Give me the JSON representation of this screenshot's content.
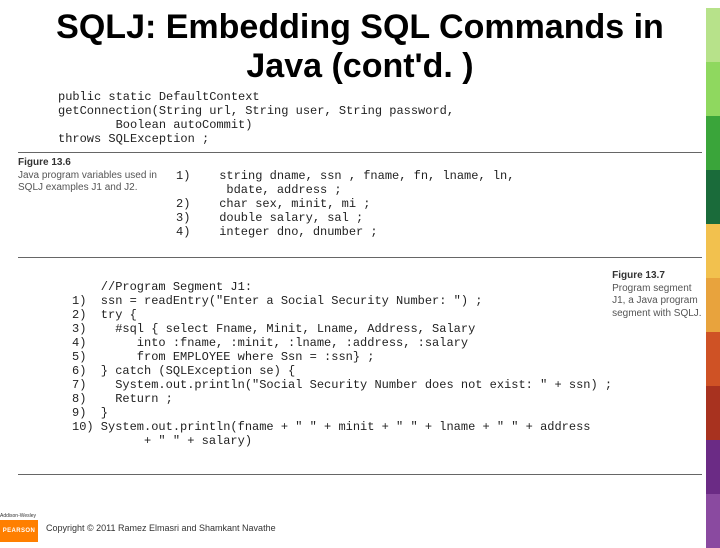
{
  "title": "SQLJ: Embedding SQL Commands in Java (cont'd. )",
  "code_block1": "public static DefaultContext\ngetConnection(String url, String user, String password,\n        Boolean autoCommit)\nthrows SQLException ;",
  "fig136": {
    "label": "Figure 13.6",
    "caption": "Java program variables used in SQLJ examples J1 and J2."
  },
  "code_block2": "1)    string dname, ssn , fname, fn, lname, ln,\n       bdate, address ;\n2)    char sex, minit, mi ;\n3)    double salary, sal ;\n4)    integer dno, dnumber ;",
  "code_block3": "    //Program Segment J1:\n1)  ssn = readEntry(\"Enter a Social Security Number: \") ;\n2)  try {\n3)    #sql { select Fname, Minit, Lname, Address, Salary\n4)       into :fname, :minit, :lname, :address, :salary\n5)       from EMPLOYEE where Ssn = :ssn} ;\n6)  } catch (SQLException se) {\n7)    System.out.println(\"Social Security Number does not exist: \" + ssn) ;\n8)    Return ;\n9)  }\n10) System.out.println(fname + \" \" + minit + \" \" + lname + \" \" + address\n          + \" \" + salary)",
  "fig137": {
    "label": "Figure 13.7",
    "caption": "Program segment J1, a Java program segment with SQLJ."
  },
  "stripe_colors": [
    "#b7e28a",
    "#8fd85f",
    "#3aa53a",
    "#1a6b3a",
    "#f2c14e",
    "#e8a33d",
    "#cf5225",
    "#a8321f",
    "#6b2b85",
    "#8a4aa0"
  ],
  "logo": {
    "aw": "Addison-Wesley",
    "text": "PEARSON"
  },
  "copyright": "Copyright © 2011 Ramez Elmasri and Shamkant Navathe"
}
